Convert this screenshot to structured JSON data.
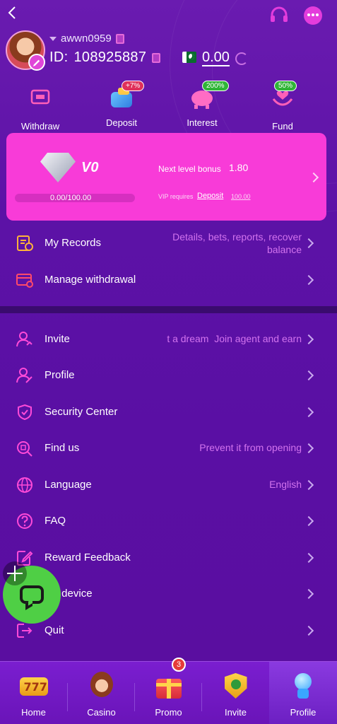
{
  "user": {
    "username": "awwn0959",
    "id_label": "ID:",
    "id_value": "108925887",
    "balance": "0.00"
  },
  "quick_actions": [
    {
      "label": "Withdraw",
      "badge": "",
      "icon": "wallet-ticket-icon"
    },
    {
      "label": "Deposit",
      "badge": "+7%",
      "icon": "wallet-deposit-icon",
      "badge_color": "#e0305a"
    },
    {
      "label": "Interest",
      "badge": "200%",
      "icon": "piggy-bank-icon",
      "badge_color": "#2fb536"
    },
    {
      "label": "Fund",
      "badge": "50%",
      "icon": "hands-heart-icon",
      "badge_color": "#2fb536"
    }
  ],
  "vip": {
    "level": "V0",
    "next_bonus_label": "Next level bonus",
    "next_bonus_value": "1.80",
    "progress_text": "0.00/100.00",
    "progress_fraction": 0,
    "requires_label": "VIP requires",
    "deposit_label": "Deposit",
    "deposit_amount": "100.00",
    "bg_color": "#f83bd8"
  },
  "records_rows": [
    {
      "label": "My Records",
      "value": "Details, bets, reports, recover balance",
      "icon": "records-icon"
    },
    {
      "label": "Manage withdrawal",
      "value": "",
      "icon": "card-withdraw-icon"
    }
  ],
  "menu_rows": [
    {
      "label": "Invite",
      "value": "t a dream  Join agent and earn",
      "icon": "invite-user-icon"
    },
    {
      "label": "Profile",
      "value": "",
      "icon": "profile-icon"
    },
    {
      "label": "Security Center",
      "value": "",
      "icon": "shield-icon"
    },
    {
      "label": "Find us",
      "value": "Prevent it from opening",
      "icon": "find-us-icon"
    },
    {
      "label": "Language",
      "value": "English",
      "icon": "globe-icon"
    },
    {
      "label": "FAQ",
      "value": "",
      "icon": "question-icon"
    },
    {
      "label": "Reward Feedback",
      "value": "",
      "icon": "edit-feedback-icon"
    },
    {
      "label": "gin device",
      "value": "",
      "icon": "device-icon"
    },
    {
      "label": "Quit",
      "value": "",
      "icon": "logout-icon"
    }
  ],
  "bottom_nav": [
    {
      "label": "Home",
      "icon": "home-777-icon"
    },
    {
      "label": "Casino",
      "icon": "casino-girl-icon"
    },
    {
      "label": "Promo",
      "icon": "gift-box-icon",
      "badge": "3"
    },
    {
      "label": "Invite",
      "icon": "invite-shield-icon"
    },
    {
      "label": "Profile",
      "icon": "profile-mascot-icon",
      "active": true
    }
  ],
  "colors": {
    "accent_pink": "#e43cdc",
    "value_text": "#d273ee",
    "background": "#5a0fa4"
  }
}
